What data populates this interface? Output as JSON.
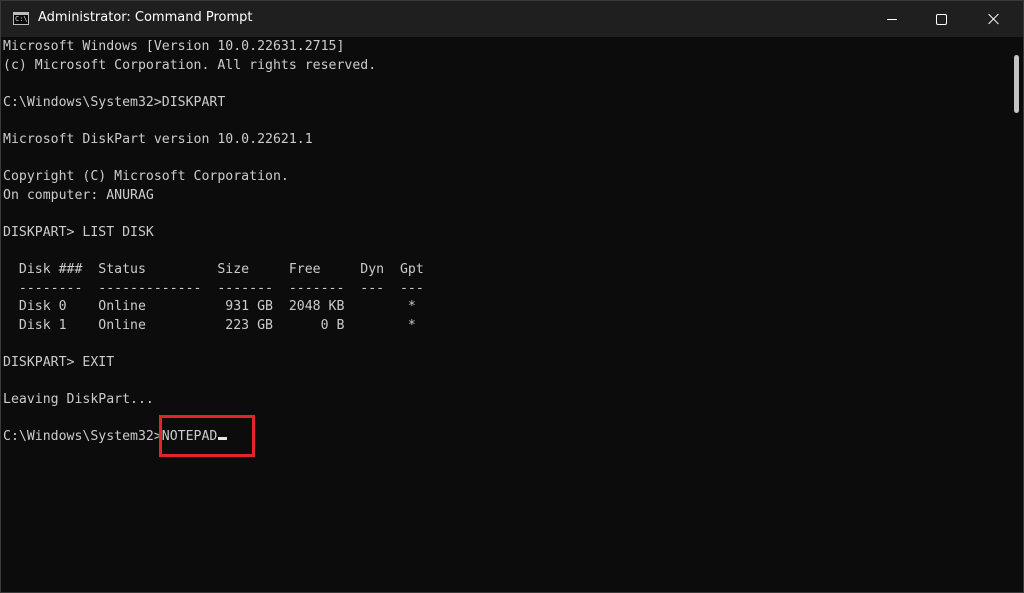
{
  "window": {
    "title": "Administrator: Command Prompt",
    "icon": "cmd-icon",
    "icon_glyph": "C:\\"
  },
  "controls": {
    "minimize": "minimize-icon",
    "maximize": "maximize-icon",
    "close": "close-icon"
  },
  "console": {
    "lines": [
      "Microsoft Windows [Version 10.0.22631.2715]",
      "(c) Microsoft Corporation. All rights reserved.",
      "",
      "C:\\Windows\\System32>DISKPART",
      "",
      "Microsoft DiskPart version 10.0.22621.1",
      "",
      "Copyright (C) Microsoft Corporation.",
      "On computer: ANURAG",
      "",
      "DISKPART> LIST DISK",
      "",
      "  Disk ###  Status         Size     Free     Dyn  Gpt",
      "  --------  -------------  -------  -------  ---  ---",
      "  Disk 0    Online          931 GB  2048 KB        *",
      "  Disk 1    Online          223 GB      0 B        *",
      "",
      "DISKPART> EXIT",
      "",
      "Leaving DiskPart...",
      ""
    ],
    "prompt": "C:\\Windows\\System32>",
    "current_input": "NOTEPAD"
  },
  "colors": {
    "background": "#0c0c0c",
    "text": "#cccccc",
    "titlebar": "#1f1f1f",
    "highlight": "#e3242b"
  }
}
